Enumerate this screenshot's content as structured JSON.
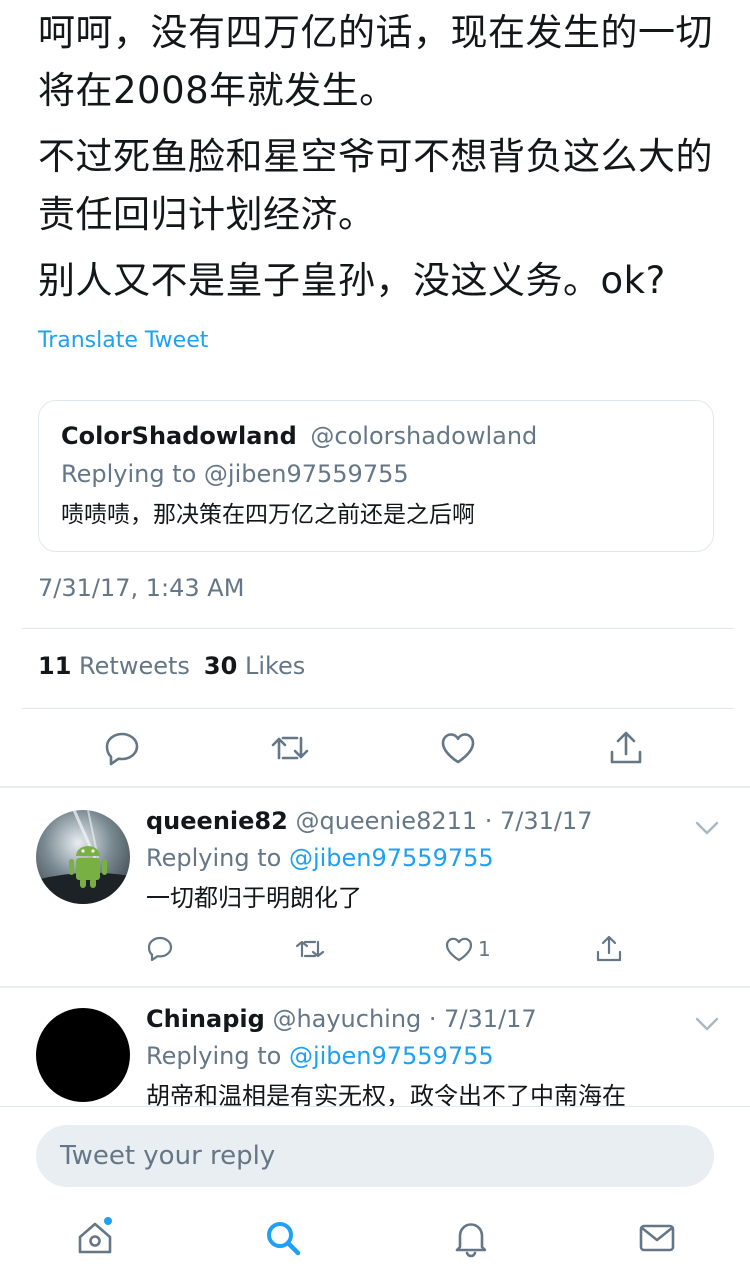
{
  "tweet": {
    "paragraphs": [
      "呵呵，没有四万亿的话，现在发生的一切将在2008年就发生。",
      "不过死鱼脸和星空爷可不想背负这么大的责任回归计划经济。",
      "别人又不是皇子皇孙，没这义务。ok?"
    ],
    "translate_label": "Translate Tweet",
    "timestamp": "7/31/17, 1:43 AM",
    "retweets_count": "11",
    "retweets_label": "Retweets",
    "likes_count": "30",
    "likes_label": "Likes"
  },
  "quoted": {
    "name": "ColorShadowland",
    "handle": "@colorshadowland",
    "replying_to": "Replying to @jiben97559755",
    "text": "啧啧啧，那决策在四万亿之前还是之后啊"
  },
  "replies": [
    {
      "name": "queenie82",
      "meta": "@queenie8211 · 7/31/17",
      "replying_prefix": "Replying to ",
      "mention": "@jiben97559755",
      "text": "一切都归于明朗化了",
      "like_count": "1",
      "avatar": "android-figure-avatar"
    },
    {
      "name": "Chinapig",
      "meta": "@hayuching · 7/31/17",
      "replying_prefix": "Replying to ",
      "mention": "@jiben97559755",
      "text": "胡帝和温相是有实无权，政令出不了中南海在",
      "avatar": "black-circle-avatar"
    }
  ],
  "compose": {
    "placeholder": "Tweet your reply"
  },
  "tabbar": {
    "items": [
      "home-icon",
      "search-icon",
      "notifications-bell-icon",
      "messages-envelope-icon"
    ],
    "home_has_badge": true
  },
  "colors": {
    "accent": "#1da1f2",
    "text_primary": "#14171a",
    "text_secondary": "#657786",
    "icon_gray": "#657786",
    "compose_bg": "#e9eef3"
  }
}
